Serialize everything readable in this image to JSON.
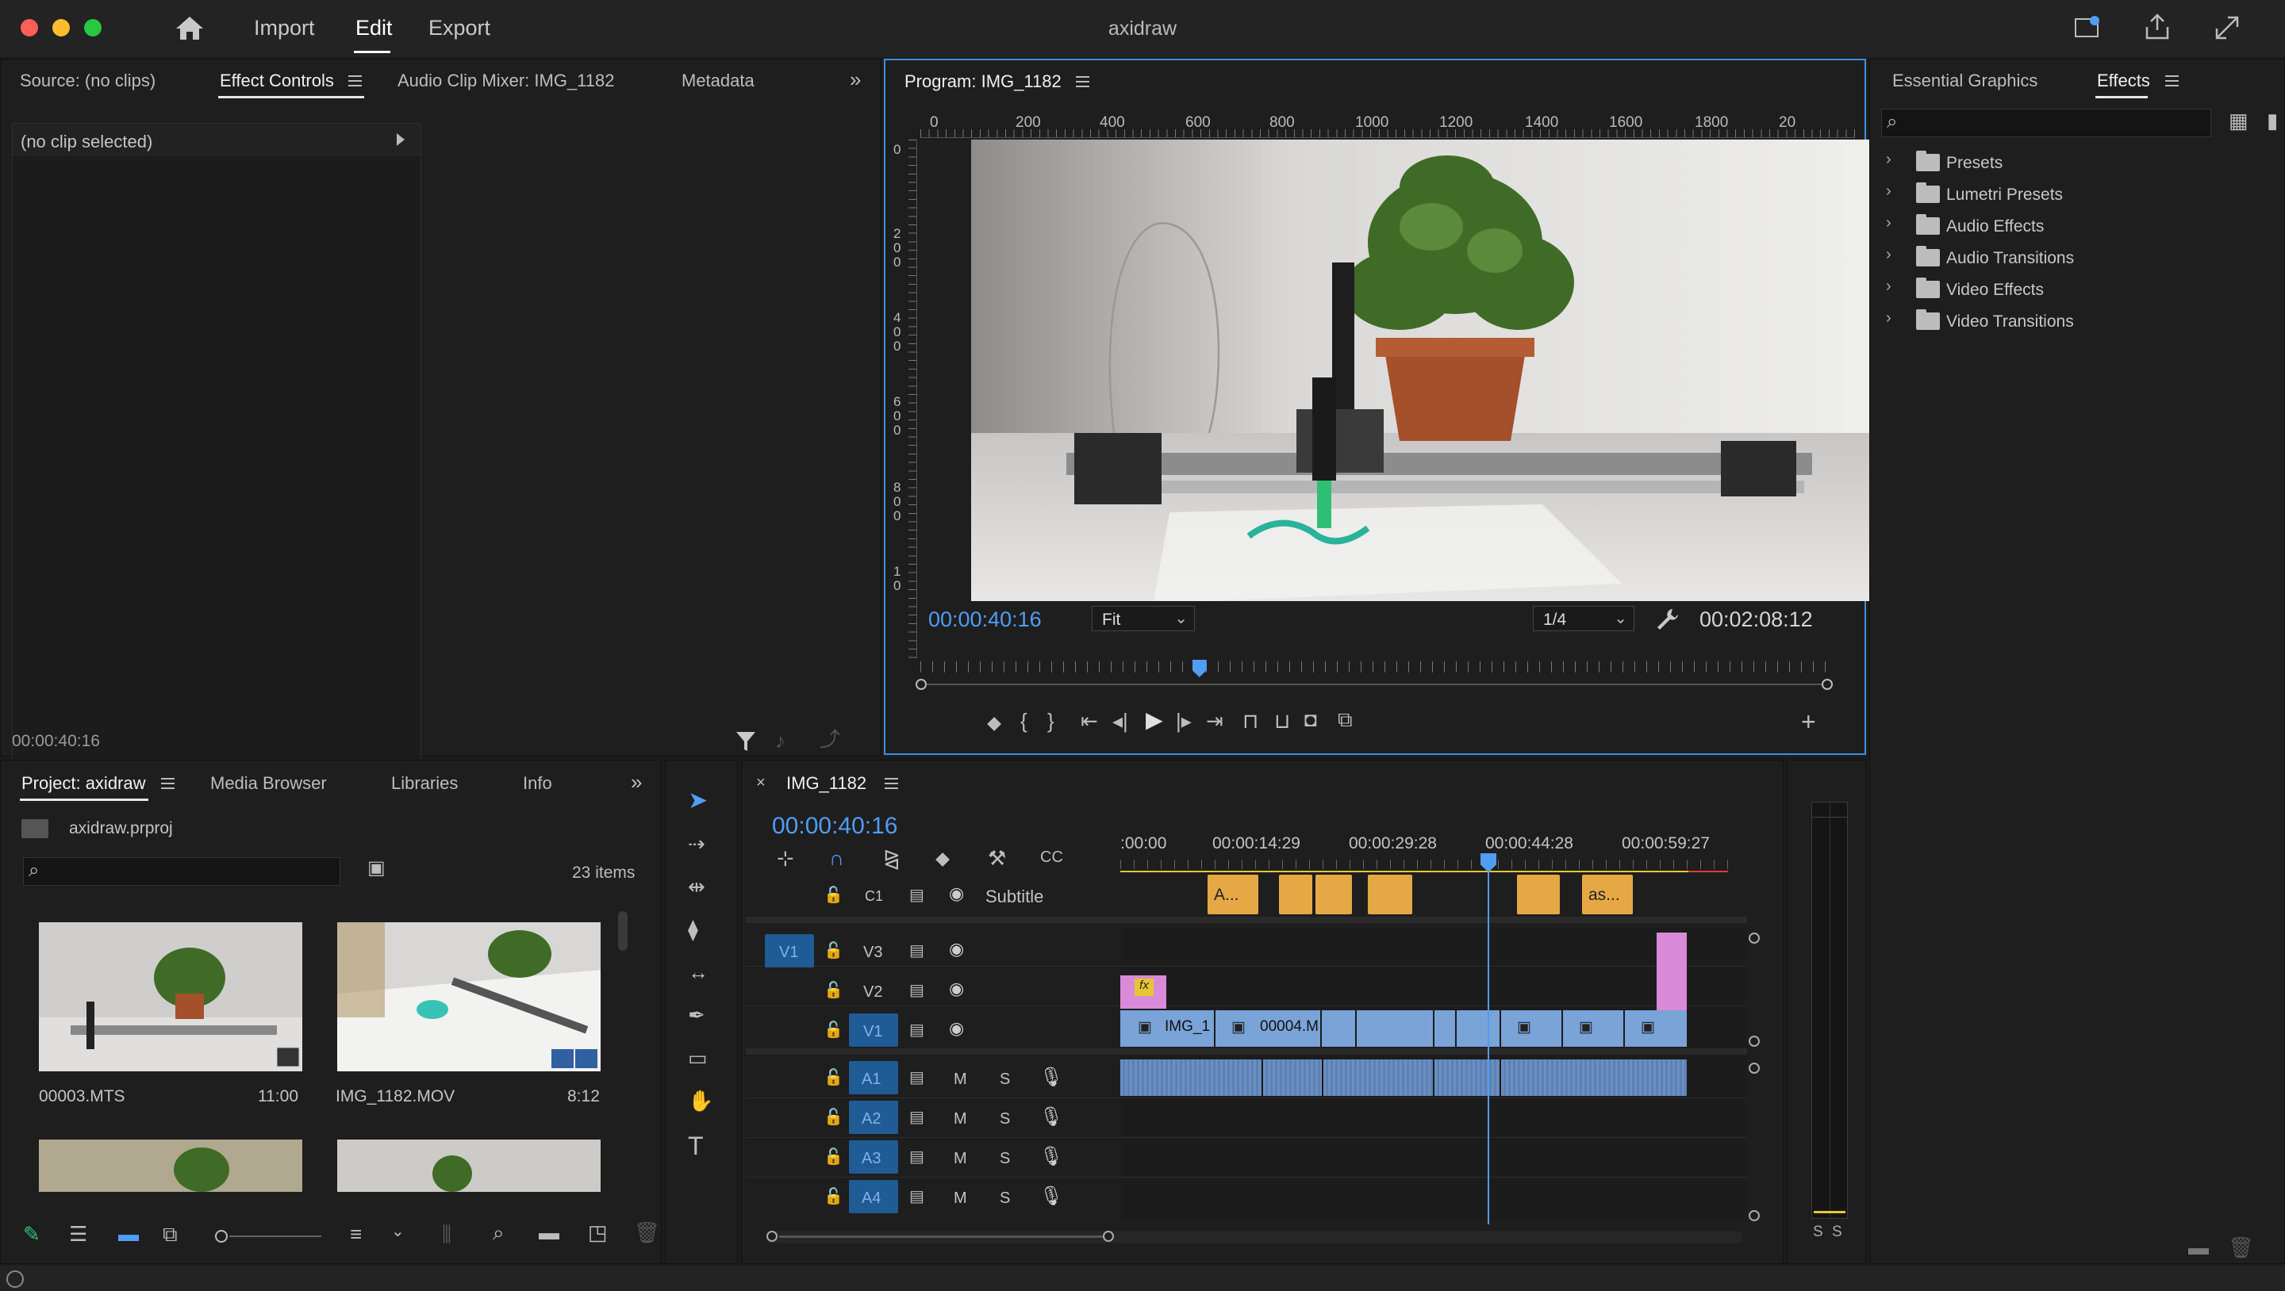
{
  "app": {
    "title": "axidraw",
    "nav": [
      "Import",
      "Edit",
      "Export"
    ],
    "active_nav": "Edit"
  },
  "source_panel": {
    "tabs": [
      "Source: (no clips)",
      "Effect Controls",
      "Audio Clip Mixer: IMG_1182",
      "Metadata"
    ],
    "no_clip": "(no clip selected)",
    "timecode": "00:00:40:16"
  },
  "program_monitor": {
    "title": "Program: IMG_1182",
    "ruler_top": [
      "0",
      "200",
      "400",
      "600",
      "800",
      "1000",
      "1200",
      "1400",
      "1600",
      "1800",
      "20"
    ],
    "ruler_left": [
      "0",
      "2\n0\n0",
      "4\n0\n0",
      "6\n0\n0",
      "8\n0\n0",
      "1\n0"
    ],
    "current_time": "00:00:40:16",
    "fit": "Fit",
    "resolution": "1/4",
    "duration": "00:02:08:12",
    "playhead_fraction": 0.308
  },
  "effects_panel": {
    "tabs": [
      "Essential Graphics",
      "Effects"
    ],
    "search_placeholder": "",
    "items": [
      "Presets",
      "Lumetri Presets",
      "Audio Effects",
      "Audio Transitions",
      "Video Effects",
      "Video Transitions"
    ]
  },
  "project_panel": {
    "tabs": [
      "Project: axidraw",
      "Media Browser",
      "Libraries",
      "Info"
    ],
    "file": "axidraw.prproj",
    "count": "23 items",
    "clips": [
      {
        "name": "00003.MTS",
        "duration": "11:00"
      },
      {
        "name": "IMG_1182.MOV",
        "duration": "8:12"
      }
    ]
  },
  "timeline": {
    "sequence": "IMG_1182",
    "timecode": "00:00:40:16",
    "ruler_labels": [
      ":00:00",
      "00:00:14:29",
      "00:00:29:28",
      "00:00:44:28",
      "00:00:59:27"
    ],
    "tracks": {
      "caption": "C1",
      "caption_name": "Subtitle",
      "video": [
        "V3",
        "V2",
        "V1"
      ],
      "audio": [
        "A1",
        "A2",
        "A3",
        "A4"
      ],
      "source_patch": "V1"
    },
    "track_buttons": {
      "mute": "M",
      "solo": "S"
    },
    "caption_clips": [
      "A...",
      "as..."
    ],
    "video_clips": [
      "IMG_1",
      "00004.M"
    ],
    "fx_label": "fx"
  },
  "audio_meter": {
    "labels": [
      "S",
      "S"
    ]
  },
  "colors": {
    "accent": "#4f9df5",
    "caption": "#e6a845",
    "video_clip": "#7aa3d8",
    "audio_clip": "#6a8fc2",
    "pink_clip": "#d98ad9"
  }
}
